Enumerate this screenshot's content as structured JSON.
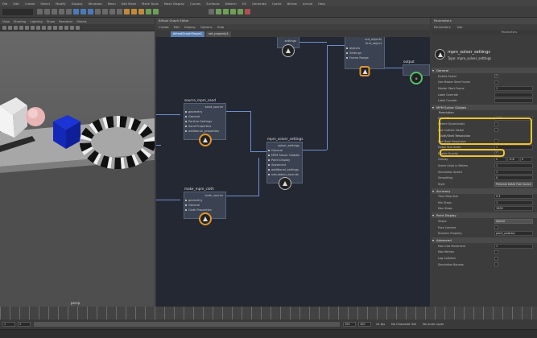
{
  "menubar": {
    "items": [
      "File",
      "Edit",
      "Create",
      "Select",
      "Modify",
      "Display",
      "Windows",
      "Mesh",
      "Edit Mesh",
      "Mesh Tools",
      "Mesh Display",
      "Curves",
      "Surfaces",
      "Deform",
      "UV",
      "Generate",
      "Cache",
      "Bifrost",
      "Arnold",
      "Help"
    ]
  },
  "viewport": {
    "menu": [
      "View",
      "Shading",
      "Lighting",
      "Show",
      "Renderer",
      "Panels"
    ],
    "camera_label": "persp"
  },
  "graph_editor": {
    "title": "Bifrost Graph Editor",
    "menu": [
      "Create",
      "Edit",
      "Display",
      "Options",
      "Help"
    ],
    "tabs": [
      "bifrostGraphShape1",
      "set_property1"
    ],
    "nodes": {
      "top_left": {
        "out_label": "settings"
      },
      "top_mid": {
        "rows": [
          "out_objects",
          "first_object",
          "objects",
          "Settings",
          "Frame Range"
        ]
      },
      "output": {
        "title": "output"
      },
      "source_mpm_sand": {
        "title": "source_mpm_sand",
        "out_label": "sand_source",
        "rows": [
          "geometry",
          "General",
          "Particle Settings",
          "Sand Properties",
          "additional_properties"
        ]
      },
      "mpm_solver_settings": {
        "title": "mpm_solver_settings",
        "out_label": "solver_settings",
        "rows": [
          "General",
          "MPM Solver Globals",
          "Point Display",
          "Advanced",
          "additional_settings",
          "simulation_bounds"
        ]
      },
      "make_mpm_cloth": {
        "title": "make_mpm_cloth",
        "out_label": "cloth_source",
        "rows": [
          "geometry",
          "General",
          "Cloth Properties"
        ]
      }
    }
  },
  "attribute_editor": {
    "title": "Parameters",
    "tabs": [
      "Parameters",
      "Info"
    ],
    "sub_label": "Parameters",
    "node_name": "mpm_solver_settings",
    "node_type": "Type: mpm_solver_settings",
    "sections": {
      "general": {
        "title": "General",
        "rows": [
          {
            "label": "Enable Solver",
            "kind": "checkbox",
            "checked": true
          },
          {
            "label": "Use Master Start Frame",
            "kind": "checkbox",
            "checked": false
          },
          {
            "label": "Master Start Frame",
            "kind": "field",
            "value": "1"
          },
          {
            "label": "Label Override",
            "kind": "field",
            "value": ""
          },
          {
            "label": "Label Counter",
            "kind": "field",
            "value": ""
          }
        ]
      },
      "mpm_globals": {
        "title": "MPM Solver Globals",
        "resolution_title": "Resolution",
        "resolution_rows": [
          {
            "label": "Detail Size",
            "value": "0.15"
          },
          {
            "label": "Detect Dynamically",
            "value": ""
          },
          {
            "label": "Link Collider Detail",
            "value": ""
          }
        ],
        "cloth_title": "Cloth/Shell Resolution",
        "cloth_rows": [
          {
            "label": "Use Mesh Resolution",
            "value": ""
          },
          {
            "label": "Detail Size Scale",
            "value": "1"
          }
        ],
        "other_rows": [
          {
            "label": "Enable Gravity",
            "kind": "checkbox",
            "checked": true
          },
          {
            "label": "Gravity",
            "kind": "vector",
            "values": [
              "0",
              "-9.8",
              "0"
            ]
          },
          {
            "label": "Scene Units in Meters",
            "kind": "field",
            "value": "1"
          },
          {
            "label": "Simulation Speed",
            "kind": "field",
            "value": "1"
          },
          {
            "label": "Smoothing",
            "kind": "field",
            "value": "0"
          },
          {
            "label": "Style",
            "kind": "dropdown",
            "value": "Preserve Detail Fast Source"
          }
        ]
      },
      "accuracy": {
        "title": "Accuracy",
        "rows": [
          {
            "label": "Time Step Size",
            "value": "0.4"
          },
          {
            "label": "Min Steps",
            "value": "1"
          },
          {
            "label": "Max Steps",
            "value": "1000"
          }
        ]
      },
      "point_display": {
        "title": "Point Display",
        "rows": [
          {
            "label": "Shape",
            "kind": "dropdown",
            "value": "Sphere"
          },
          {
            "label": "Face Camera",
            "kind": "checkbox",
            "checked": false
          },
          {
            "label": "Numeric Property",
            "kind": "field",
            "value": "point_position"
          }
        ]
      },
      "advanced": {
        "title": "Advanced",
        "rows": [
          {
            "label": "Max Grid Movement",
            "value": "1"
          },
          {
            "label": "Max Retries",
            "value": ""
          },
          {
            "label": "Lag Colliders",
            "value": ""
          },
          {
            "label": "Simulation Bounds",
            "value": ""
          }
        ]
      }
    }
  },
  "timeline": {
    "start": "1",
    "end": "100",
    "range_start": "1",
    "range_end": "100",
    "fps": "24 fps",
    "character_set": "No Character Set",
    "anim_layer": "No Anim Layer"
  },
  "colors": {
    "highlight": "#f2c52a",
    "graph_bg": "#242833",
    "wire": "#6f8fcf",
    "node_border_orange": "#e0962e",
    "node_border_green": "#56c06a"
  }
}
